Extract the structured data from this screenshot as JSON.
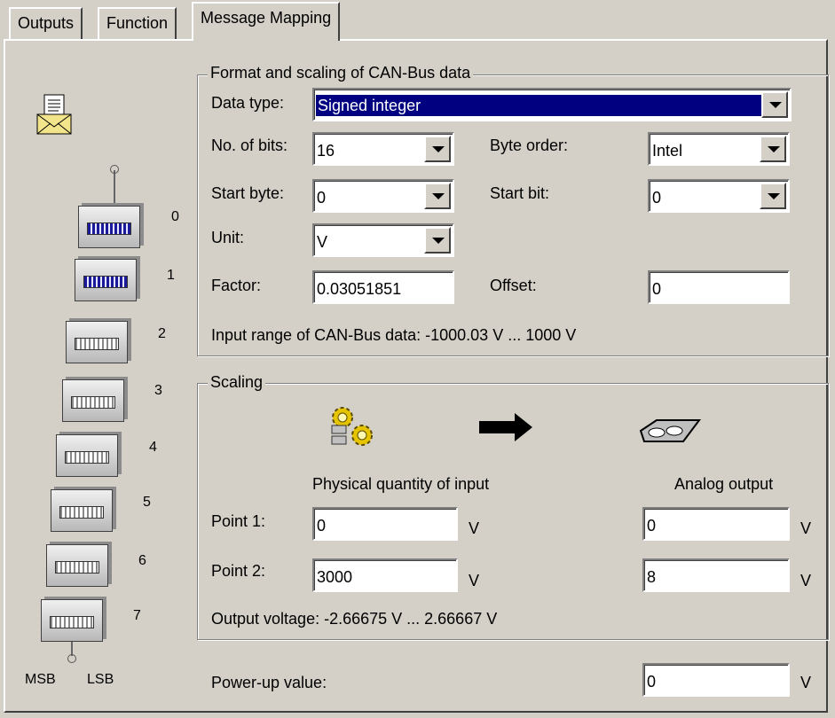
{
  "tabs": [
    "Outputs",
    "Function",
    "Message Mapping"
  ],
  "format_group": {
    "title": "Format and scaling of CAN-Bus data",
    "data_type_label": "Data type:",
    "data_type_value": "Signed integer",
    "bits_label": "No. of bits:",
    "bits_value": "16",
    "byte_order_label": "Byte order:",
    "byte_order_value": "Intel",
    "start_byte_label": "Start byte:",
    "start_byte_value": "0",
    "start_bit_label": "Start bit:",
    "start_bit_value": "0",
    "unit_label": "Unit:",
    "unit_value": "V",
    "factor_label": "Factor:",
    "factor_value": "0.03051851",
    "offset_label": "Offset:",
    "offset_value": "0",
    "input_range": "Input range of CAN-Bus data: -1000.03 V ... 1000 V"
  },
  "scaling_group": {
    "title": "Scaling",
    "physical_header": "Physical quantity of input",
    "analog_header": "Analog output",
    "point1_label": "Point 1:",
    "point1_input": "0",
    "point1_output": "0",
    "point2_label": "Point 2:",
    "point2_input": "3000",
    "point2_output": "8",
    "unit": "V",
    "output_voltage": "Output voltage: -2.66675 V ... 2.66667 V"
  },
  "power_up": {
    "label": "Power-up value:",
    "value": "0",
    "unit": "V"
  },
  "byte_stack": {
    "numbers": [
      "0",
      "1",
      "2",
      "3",
      "4",
      "5",
      "6",
      "7"
    ],
    "msb_label": "MSB",
    "lsb_label": "LSB"
  },
  "icons": {
    "message": "envelope-document-icon",
    "input": "gears-icon",
    "arrow": "right-arrow-icon",
    "output": "analog-module-icon"
  }
}
